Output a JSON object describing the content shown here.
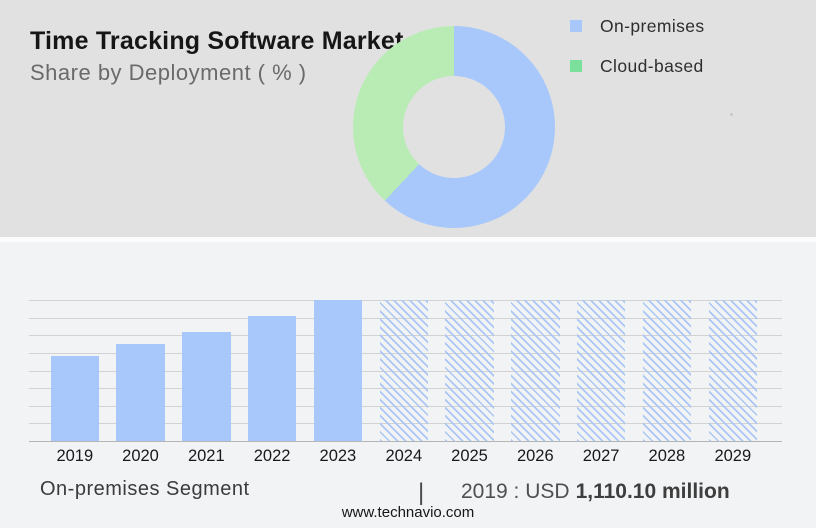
{
  "page": {
    "title": "Time Tracking Software Market",
    "subtitle": "Share by Deployment ( % )",
    "website": "www.technavio.com"
  },
  "colors": {
    "header_bg": "#e1e1e1",
    "body_bg": "#f2f3f5",
    "primary_blue": "#a8c8fb",
    "donut_green": "#b9ecb5",
    "legend_green": "#7ae09c",
    "hatch_blue": "#a9c6f4",
    "gridline": "#d2d2d2",
    "axis_line": "#b5b5b5"
  },
  "legend": {
    "items": [
      {
        "label": "On-premises",
        "color": "#a8c8fb",
        "swatch": "blue-square"
      },
      {
        "label": "Cloud-based",
        "color": "#7ae09c",
        "swatch": "green-square"
      }
    ]
  },
  "footer": {
    "segment_label": "On-premises Segment",
    "divider": "|",
    "value_prefix": "2019 : USD",
    "value_bold": "1,110.10 million"
  },
  "chart_data": [
    {
      "type": "pie",
      "subtype": "donut",
      "title": "Share by Deployment ( % )",
      "labels": [
        "On-premises",
        "Cloud-based"
      ],
      "values_percent": [
        62,
        38
      ],
      "colors": [
        "#a8c8fb",
        "#b9ecb5"
      ],
      "start_angle_deg": 0,
      "direction": "clockwise",
      "legend_position": "right"
    },
    {
      "type": "bar",
      "title": "On-premises Segment",
      "categories": [
        "2019",
        "2020",
        "2021",
        "2022",
        "2023",
        "2024",
        "2025",
        "2026",
        "2027",
        "2028",
        "2029"
      ],
      "values_fraction_of_max": [
        0.6,
        0.69,
        0.77,
        0.89,
        1.0,
        1.0,
        1.0,
        1.0,
        1.0,
        1.0,
        1.0
      ],
      "forecast_years": [
        "2024",
        "2025",
        "2026",
        "2027",
        "2028",
        "2029"
      ],
      "actual_bar_style": "solid",
      "forecast_bar_style": "hatched",
      "known_values": {
        "2019": "USD 1,110.10 million"
      },
      "xlabel": "",
      "ylabel": "",
      "y_axis_tick_labels": false,
      "gridline_rows": 8,
      "grid": true
    }
  ]
}
